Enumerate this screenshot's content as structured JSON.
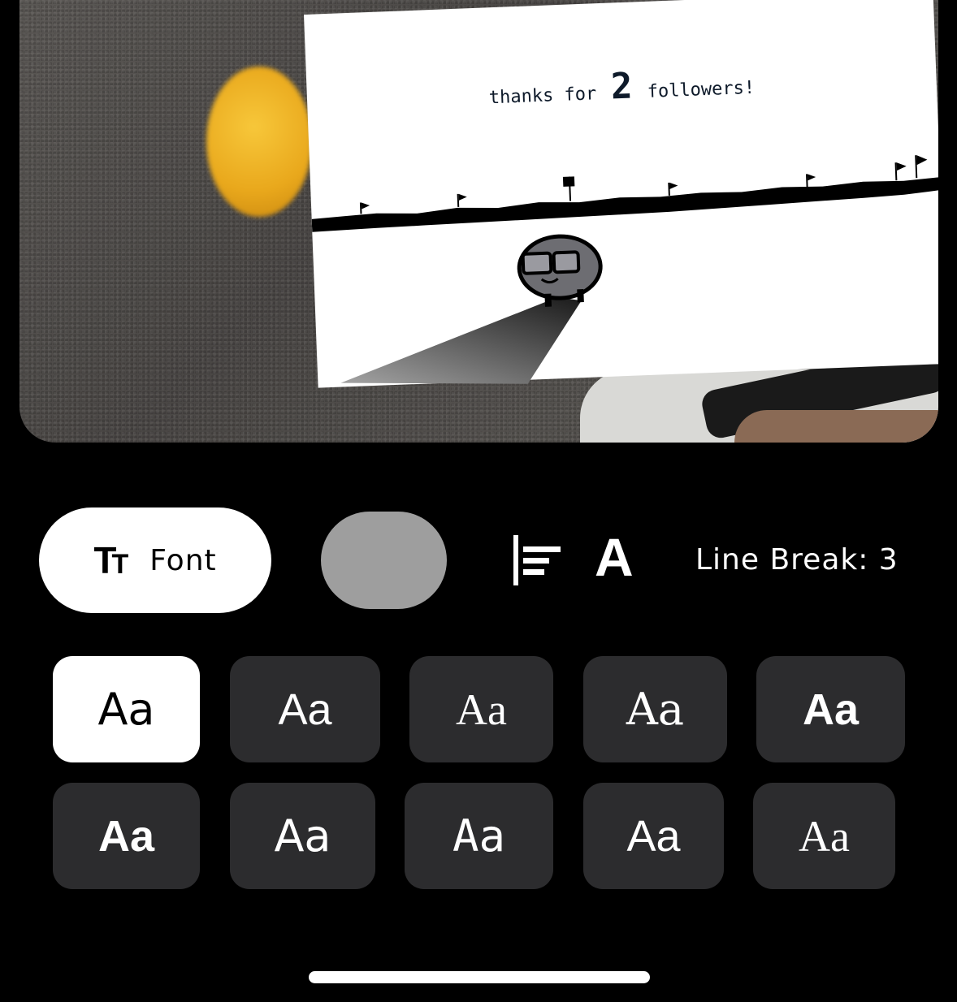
{
  "preview": {
    "card_text_before": "thanks for",
    "card_number": "2",
    "card_text_after": "followers!"
  },
  "toolbar": {
    "font_icon": "text-size-icon",
    "font_label": "Font",
    "color_swatch": "#9e9e9e",
    "align_icon": "align-left-icon",
    "text_style_icon": "text-style-icon",
    "text_style_label": "A",
    "line_break_label": "Line Break: 3"
  },
  "font_options": [
    {
      "label": "Aa",
      "selected": true
    },
    {
      "label": "Aa",
      "selected": false
    },
    {
      "label": "Aa",
      "selected": false
    },
    {
      "label": "Aa",
      "selected": false
    },
    {
      "label": "Aa",
      "selected": false
    },
    {
      "label": "Aa",
      "selected": false
    },
    {
      "label": "Aa",
      "selected": false
    },
    {
      "label": "Aa",
      "selected": false
    },
    {
      "label": "Aa",
      "selected": false
    },
    {
      "label": "Aa",
      "selected": false
    }
  ],
  "colors": {
    "background": "#000000",
    "tile": "#2c2c2e",
    "selected_tile": "#ffffff"
  }
}
